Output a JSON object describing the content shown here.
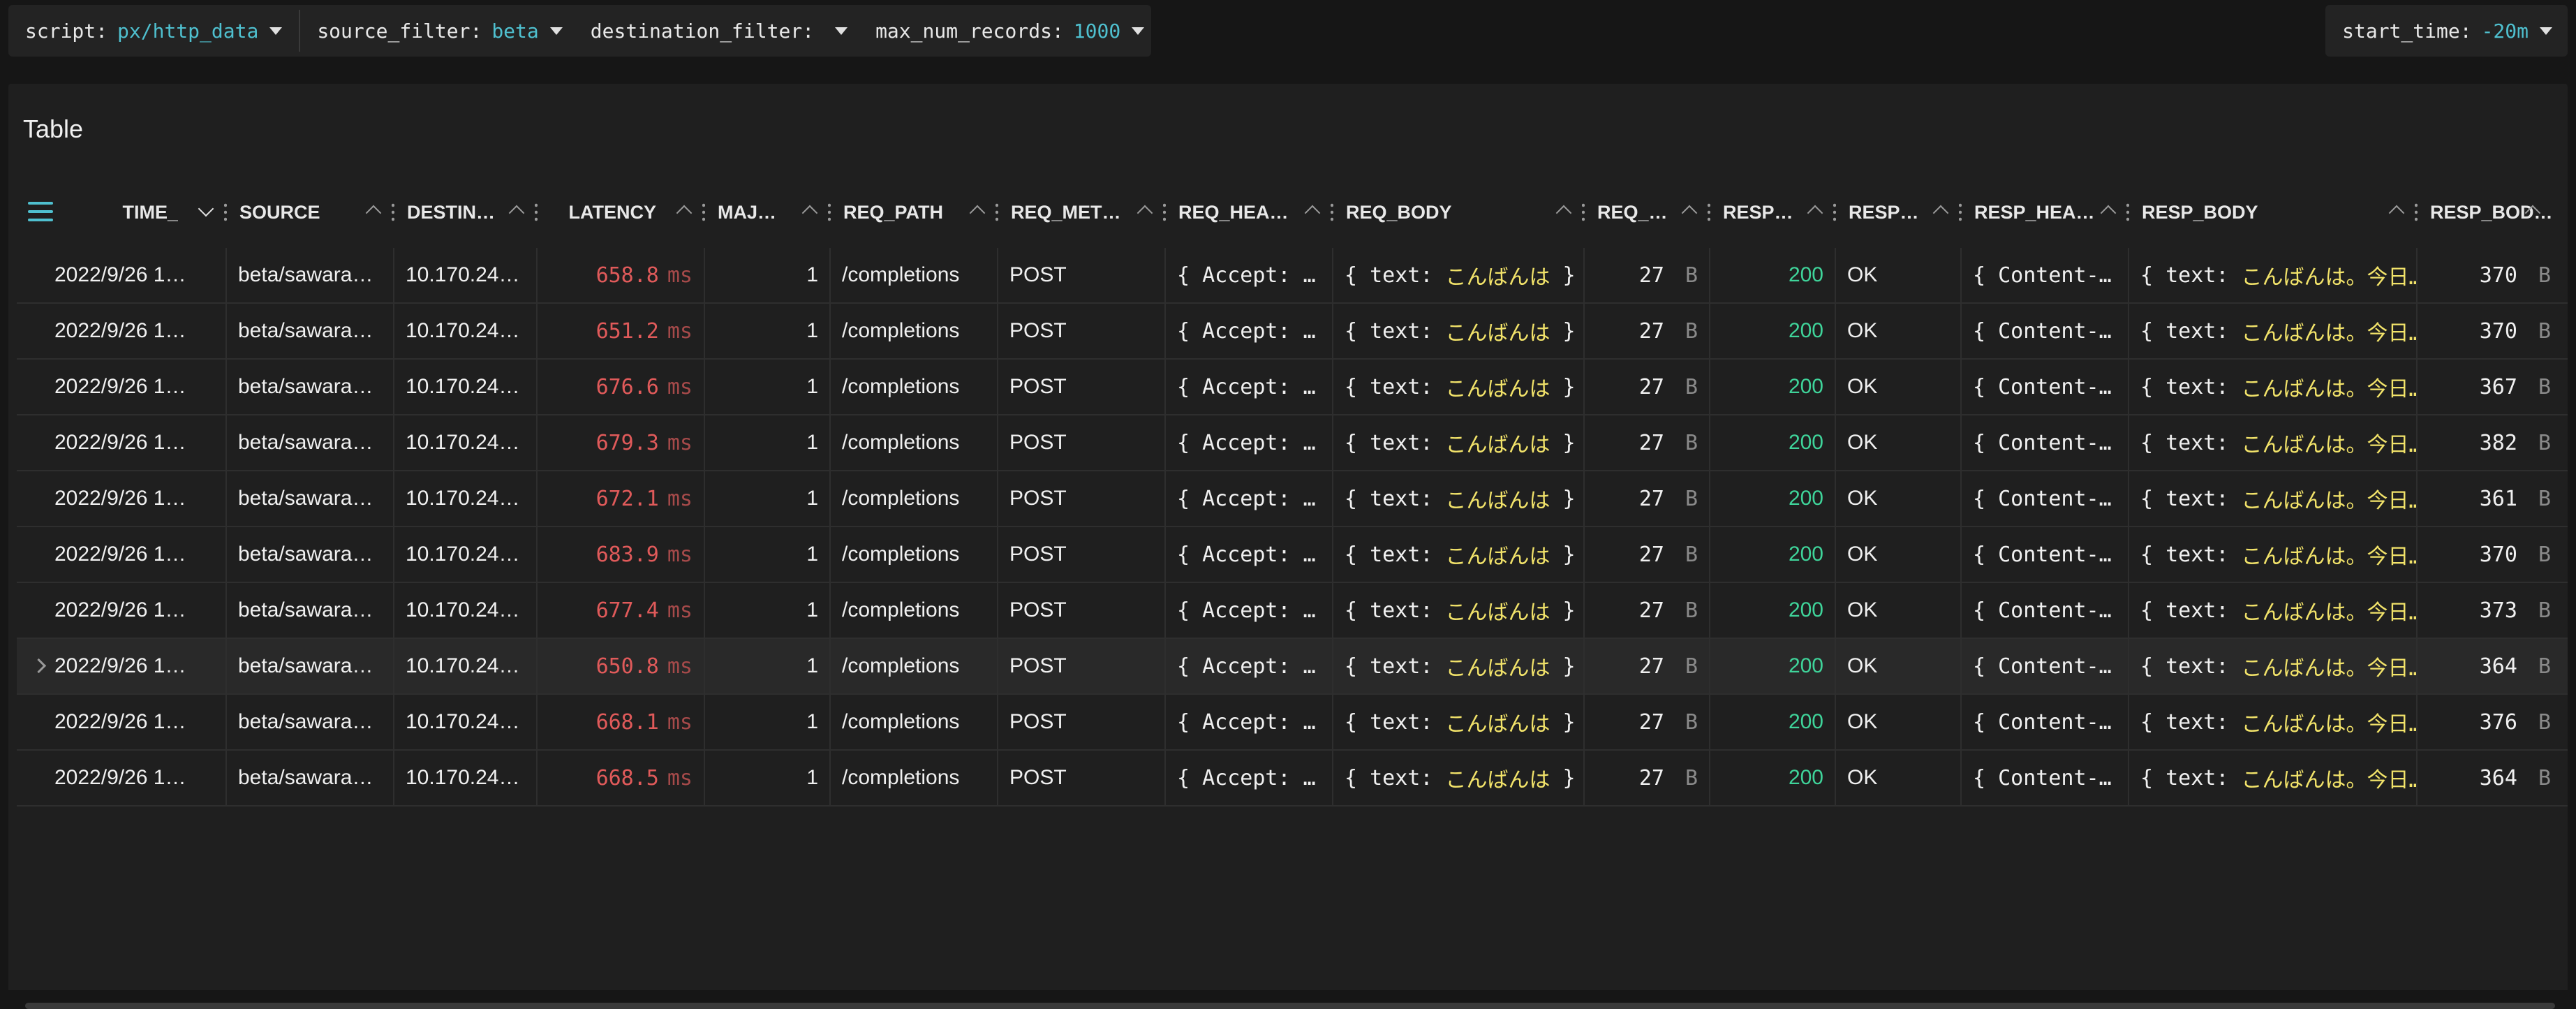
{
  "toolbar": {
    "vars": [
      {
        "key": "script:",
        "value": "px/http_data"
      },
      {
        "key": "source_filter:",
        "value": "beta"
      },
      {
        "key": "destination_filter:",
        "value": ""
      },
      {
        "key": "max_num_records:",
        "value": "1000"
      }
    ],
    "start_time": {
      "key": "start_time:",
      "value": "-20m"
    }
  },
  "panel": {
    "title": "Table"
  },
  "columns": [
    "TIME_",
    "SOURCE",
    "DESTIN…",
    "LATENCY",
    "MAJ…",
    "REQ_PATH",
    "REQ_MET…",
    "REQ_HEA…",
    "REQ_BODY",
    "REQ_…",
    "RESP…",
    "RESP…",
    "RESP_HEA…",
    "RESP_BODY",
    "RESP_BOD…"
  ],
  "rows": [
    {
      "time": "2022/9/26 1…",
      "source": "beta/sawara…",
      "dest": "10.170.24…",
      "latency": "658.8",
      "latency_unit": "ms",
      "major": "1",
      "req_path": "/completions",
      "req_method": "POST",
      "req_headers": "{ Accept: …",
      "req_body_prefix": "{ text: ",
      "req_body_jp": "こんばんは",
      "req_body_suffix": " }",
      "req_size": "27",
      "req_size_unit": "B",
      "resp_status": "200",
      "resp_message": "OK",
      "resp_headers": "{ Content-…",
      "resp_body_prefix": "{ text: ",
      "resp_body_jp": "こんばんは。今日…",
      "resp_size": "370",
      "resp_size_unit": "B"
    },
    {
      "time": "2022/9/26 1…",
      "source": "beta/sawara…",
      "dest": "10.170.24…",
      "latency": "651.2",
      "latency_unit": "ms",
      "major": "1",
      "req_path": "/completions",
      "req_method": "POST",
      "req_headers": "{ Accept: …",
      "req_body_prefix": "{ text: ",
      "req_body_jp": "こんばんは",
      "req_body_suffix": " }",
      "req_size": "27",
      "req_size_unit": "B",
      "resp_status": "200",
      "resp_message": "OK",
      "resp_headers": "{ Content-…",
      "resp_body_prefix": "{ text: ",
      "resp_body_jp": "こんばんは。今日…",
      "resp_size": "370",
      "resp_size_unit": "B"
    },
    {
      "time": "2022/9/26 1…",
      "source": "beta/sawara…",
      "dest": "10.170.24…",
      "latency": "676.6",
      "latency_unit": "ms",
      "major": "1",
      "req_path": "/completions",
      "req_method": "POST",
      "req_headers": "{ Accept: …",
      "req_body_prefix": "{ text: ",
      "req_body_jp": "こんばんは",
      "req_body_suffix": " }",
      "req_size": "27",
      "req_size_unit": "B",
      "resp_status": "200",
      "resp_message": "OK",
      "resp_headers": "{ Content-…",
      "resp_body_prefix": "{ text: ",
      "resp_body_jp": "こんばんは。今日…",
      "resp_size": "367",
      "resp_size_unit": "B"
    },
    {
      "time": "2022/9/26 1…",
      "source": "beta/sawara…",
      "dest": "10.170.24…",
      "latency": "679.3",
      "latency_unit": "ms",
      "major": "1",
      "req_path": "/completions",
      "req_method": "POST",
      "req_headers": "{ Accept: …",
      "req_body_prefix": "{ text: ",
      "req_body_jp": "こんばんは",
      "req_body_suffix": " }",
      "req_size": "27",
      "req_size_unit": "B",
      "resp_status": "200",
      "resp_message": "OK",
      "resp_headers": "{ Content-…",
      "resp_body_prefix": "{ text: ",
      "resp_body_jp": "こんばんは。今日…",
      "resp_size": "382",
      "resp_size_unit": "B"
    },
    {
      "time": "2022/9/26 1…",
      "source": "beta/sawara…",
      "dest": "10.170.24…",
      "latency": "672.1",
      "latency_unit": "ms",
      "major": "1",
      "req_path": "/completions",
      "req_method": "POST",
      "req_headers": "{ Accept: …",
      "req_body_prefix": "{ text: ",
      "req_body_jp": "こんばんは",
      "req_body_suffix": " }",
      "req_size": "27",
      "req_size_unit": "B",
      "resp_status": "200",
      "resp_message": "OK",
      "resp_headers": "{ Content-…",
      "resp_body_prefix": "{ text: ",
      "resp_body_jp": "こんばんは。今日…",
      "resp_size": "361",
      "resp_size_unit": "B"
    },
    {
      "time": "2022/9/26 1…",
      "source": "beta/sawara…",
      "dest": "10.170.24…",
      "latency": "683.9",
      "latency_unit": "ms",
      "major": "1",
      "req_path": "/completions",
      "req_method": "POST",
      "req_headers": "{ Accept: …",
      "req_body_prefix": "{ text: ",
      "req_body_jp": "こんばんは",
      "req_body_suffix": " }",
      "req_size": "27",
      "req_size_unit": "B",
      "resp_status": "200",
      "resp_message": "OK",
      "resp_headers": "{ Content-…",
      "resp_body_prefix": "{ text: ",
      "resp_body_jp": "こんばんは。今日…",
      "resp_size": "370",
      "resp_size_unit": "B"
    },
    {
      "time": "2022/9/26 1…",
      "source": "beta/sawara…",
      "dest": "10.170.24…",
      "latency": "677.4",
      "latency_unit": "ms",
      "major": "1",
      "req_path": "/completions",
      "req_method": "POST",
      "req_headers": "{ Accept: …",
      "req_body_prefix": "{ text: ",
      "req_body_jp": "こんばんは",
      "req_body_suffix": " }",
      "req_size": "27",
      "req_size_unit": "B",
      "resp_status": "200",
      "resp_message": "OK",
      "resp_headers": "{ Content-…",
      "resp_body_prefix": "{ text: ",
      "resp_body_jp": "こんばんは。今日…",
      "resp_size": "373",
      "resp_size_unit": "B"
    },
    {
      "time": "2022/9/26 1…",
      "source": "beta/sawara…",
      "dest": "10.170.24…",
      "latency": "650.8",
      "latency_unit": "ms",
      "major": "1",
      "req_path": "/completions",
      "req_method": "POST",
      "req_headers": "{ Accept: …",
      "req_body_prefix": "{ text: ",
      "req_body_jp": "こんばんは",
      "req_body_suffix": " }",
      "req_size": "27",
      "req_size_unit": "B",
      "resp_status": "200",
      "resp_message": "OK",
      "resp_headers": "{ Content-…",
      "resp_body_prefix": "{ text: ",
      "resp_body_jp": "こんばんは。今日…",
      "resp_size": "364",
      "resp_size_unit": "B",
      "hovered": true
    },
    {
      "time": "2022/9/26 1…",
      "source": "beta/sawara…",
      "dest": "10.170.24…",
      "latency": "668.1",
      "latency_unit": "ms",
      "major": "1",
      "req_path": "/completions",
      "req_method": "POST",
      "req_headers": "{ Accept: …",
      "req_body_prefix": "{ text: ",
      "req_body_jp": "こんばんは",
      "req_body_suffix": " }",
      "req_size": "27",
      "req_size_unit": "B",
      "resp_status": "200",
      "resp_message": "OK",
      "resp_headers": "{ Content-…",
      "resp_body_prefix": "{ text: ",
      "resp_body_jp": "こんばんは。今日…",
      "resp_size": "376",
      "resp_size_unit": "B"
    },
    {
      "time": "2022/9/26 1…",
      "source": "beta/sawara…",
      "dest": "10.170.24…",
      "latency": "668.5",
      "latency_unit": "ms",
      "major": "1",
      "req_path": "/completions",
      "req_method": "POST",
      "req_headers": "{ Accept: …",
      "req_body_prefix": "{ text: ",
      "req_body_jp": "こんばんは",
      "req_body_suffix": " }",
      "req_size": "27",
      "req_size_unit": "B",
      "resp_status": "200",
      "resp_message": "OK",
      "resp_headers": "{ Content-…",
      "resp_body_prefix": "{ text: ",
      "resp_body_jp": "こんばんは。今日…",
      "resp_size": "364",
      "resp_size_unit": "B"
    }
  ],
  "colors": {
    "accent": "#4fc0cf",
    "latency": "#e05a5a",
    "status_ok": "#3fd49a",
    "japanese_text": "#f2e36a"
  }
}
